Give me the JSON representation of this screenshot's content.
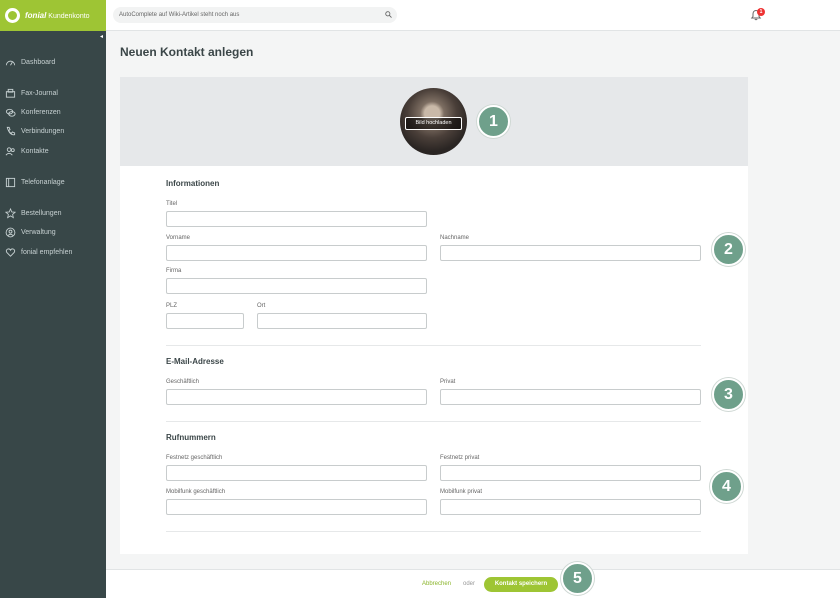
{
  "header": {
    "brand_name": "fonial",
    "brand_sub": "Kundenkonto",
    "search_placeholder": "AutoComplete auf Wiki-Artikel steht noch aus",
    "notification_count": "1"
  },
  "sidebar": {
    "collapse_glyph": "◂",
    "items": [
      {
        "label": "Dashboard",
        "icon": "dashboard-icon"
      },
      {
        "label": "Fax-Journal",
        "icon": "fax-icon"
      },
      {
        "label": "Konferenzen",
        "icon": "conference-icon"
      },
      {
        "label": "Verbindungen",
        "icon": "phone-icon"
      },
      {
        "label": "Kontakte",
        "icon": "contacts-icon"
      },
      {
        "label": "Telefonanlage",
        "icon": "pbx-icon"
      },
      {
        "label": "Bestellungen",
        "icon": "star-icon"
      },
      {
        "label": "Verwaltung",
        "icon": "user-icon"
      },
      {
        "label": "fonial empfehlen",
        "icon": "recommend-icon"
      }
    ]
  },
  "main": {
    "title": "Neuen Kontakt anlegen",
    "upload_label": "Bild hochladen",
    "sections": {
      "info": {
        "title": "Informationen",
        "titel": "Titel",
        "vorname": "Vorname",
        "nachname": "Nachname",
        "firma": "Firma",
        "plz": "PLZ",
        "ort": "Ort"
      },
      "email": {
        "title": "E-Mail-Adresse",
        "geschaeftlich": "Geschäftlich",
        "privat": "Privat"
      },
      "phone": {
        "title": "Rufnummern",
        "festnetz_geschaeftlich": "Festnetz geschäftlich",
        "festnetz_privat": "Festnetz privat",
        "mobil_geschaeftlich": "Mobilfunk geschäftlich",
        "mobil_privat": "Mobilfunk privat"
      }
    }
  },
  "footer": {
    "cancel_label": "Abbrechen",
    "or_label": "oder",
    "save_label": "Kontakt speichern"
  },
  "steps": [
    "1",
    "2",
    "3",
    "4",
    "5"
  ],
  "colors": {
    "brand_green": "#9ec534",
    "sidebar_bg": "#384748",
    "step_marker": "#6fa08b"
  }
}
